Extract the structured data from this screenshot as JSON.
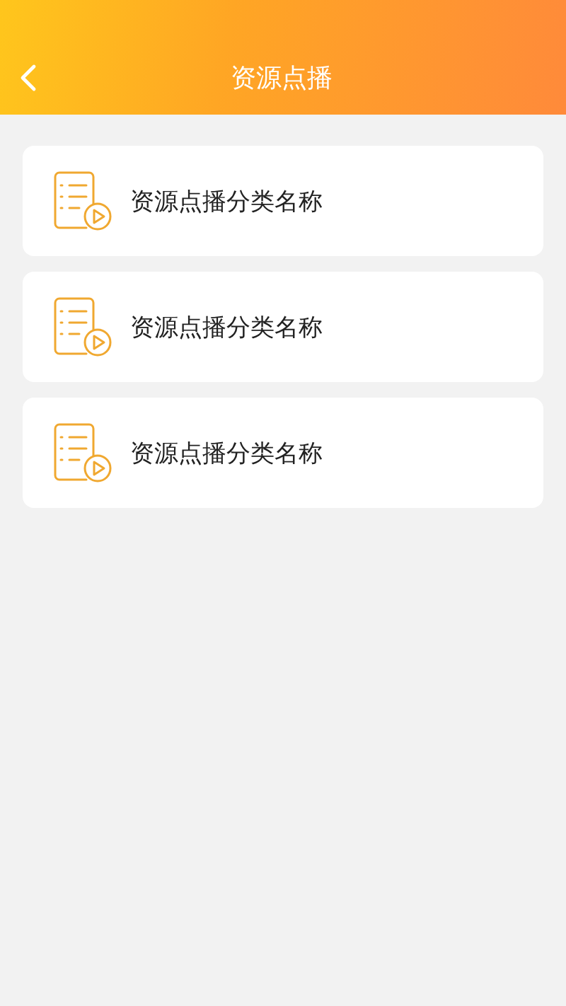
{
  "header": {
    "title": "资源点播"
  },
  "categories": [
    {
      "name": "资源点播分类名称"
    },
    {
      "name": "资源点播分类名称"
    },
    {
      "name": "资源点播分类名称"
    }
  ]
}
